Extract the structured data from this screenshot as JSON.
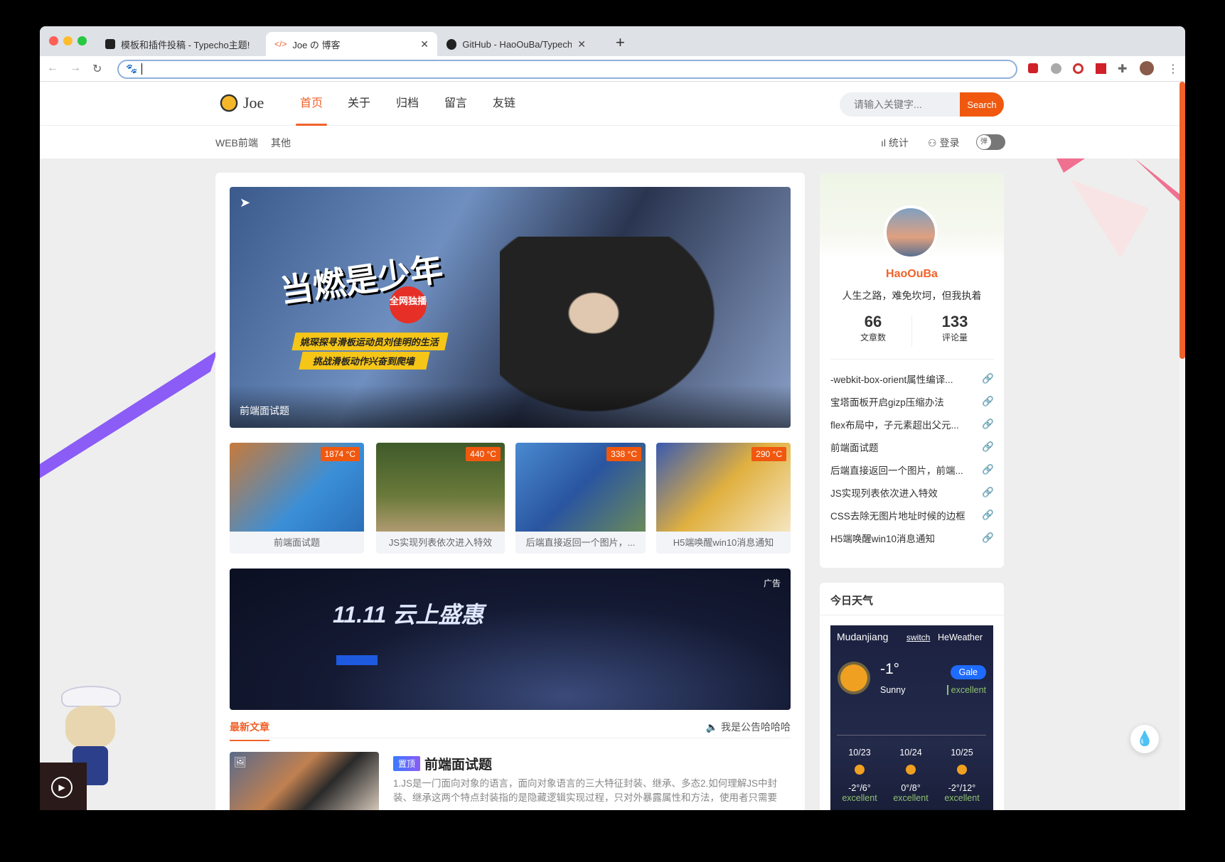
{
  "browser": {
    "tabs": [
      {
        "title": "模板和插件投稿 - Typecho主题!",
        "icon": "doc-icon"
      },
      {
        "title": "Joe の 博客",
        "icon": "code-icon"
      },
      {
        "title": "GitHub - HaoOuBa/Typecho-Jo",
        "icon": "github-icon"
      }
    ],
    "new_tab": "+",
    "url": ""
  },
  "header": {
    "logo": "Joe",
    "nav": [
      "首页",
      "关于",
      "归档",
      "留言",
      "友链"
    ],
    "search_placeholder": "请输入关键字...",
    "search_button": "Search"
  },
  "subnav": {
    "left": [
      "WEB前端",
      "其他"
    ],
    "stats": "统计",
    "login": "登录",
    "toggle": "弹"
  },
  "hero": {
    "caption": "前端面试题",
    "poster_title": "当燃是少年",
    "poster_tag": "全网独播",
    "poster_line1": "姚琛探寻滑板运动员刘佳明的生活",
    "poster_line2": "挑战滑板动作兴奋到爬墙"
  },
  "hot": [
    {
      "title": "前端面试题",
      "heat": "1874 °C"
    },
    {
      "title": "JS实现列表依次进入特效",
      "heat": "440 °C"
    },
    {
      "title": "后端直接返回一个图片，...",
      "heat": "338 °C"
    },
    {
      "title": "H5端唤醒win10消息通知",
      "heat": "290 °C"
    }
  ],
  "ad": {
    "label": "广告",
    "headline": "11.11 云上盛惠"
  },
  "latest": {
    "tab": "最新文章",
    "notice": "我是公告哈哈哈",
    "article": {
      "tag": "置顶",
      "title": "前端面试题",
      "excerpt": "1.JS是一门面向对象的语言，面向对象语言的三大特征封装、继承、多态2.如何理解JS中封装、继承这两个特点封装指的是隐藏逻辑实现过程，只对外暴露属性和方法，使用者只需要"
    }
  },
  "author": {
    "name": "HaoOuBa",
    "motto": "人生之路，难免坎坷，但我执着",
    "posts": "66",
    "posts_label": "文章数",
    "comments": "133",
    "comments_label": "评论量",
    "links": [
      "-webkit-box-orient属性编译...",
      "宝塔面板开启gizp压缩办法",
      "flex布局中，子元素超出父元...",
      "前端面试题",
      "后端直接返回一个图片，前端...",
      "JS实现列表依次进入特效",
      "CSS去除无图片地址时候的边框",
      "H5端唤醒win10消息通知"
    ]
  },
  "weather": {
    "title": "今日天气",
    "city": "Mudanjiang",
    "switch": "switch",
    "provider": "HeWeather",
    "temp": "-1°",
    "cond": "Sunny",
    "wind": "Gale",
    "aqi": "excellent",
    "forecast": [
      {
        "date": "10/23",
        "range": "-2°/6°",
        "aqi": "excellent"
      },
      {
        "date": "10/24",
        "range": "0°/8°",
        "aqi": "excellent"
      },
      {
        "date": "10/25",
        "range": "-2°/12°",
        "aqi": "excellent"
      }
    ]
  },
  "colors": {
    "accent": "#f0622a",
    "search": "#f0580f",
    "wind_badge": "#1e6bff"
  }
}
